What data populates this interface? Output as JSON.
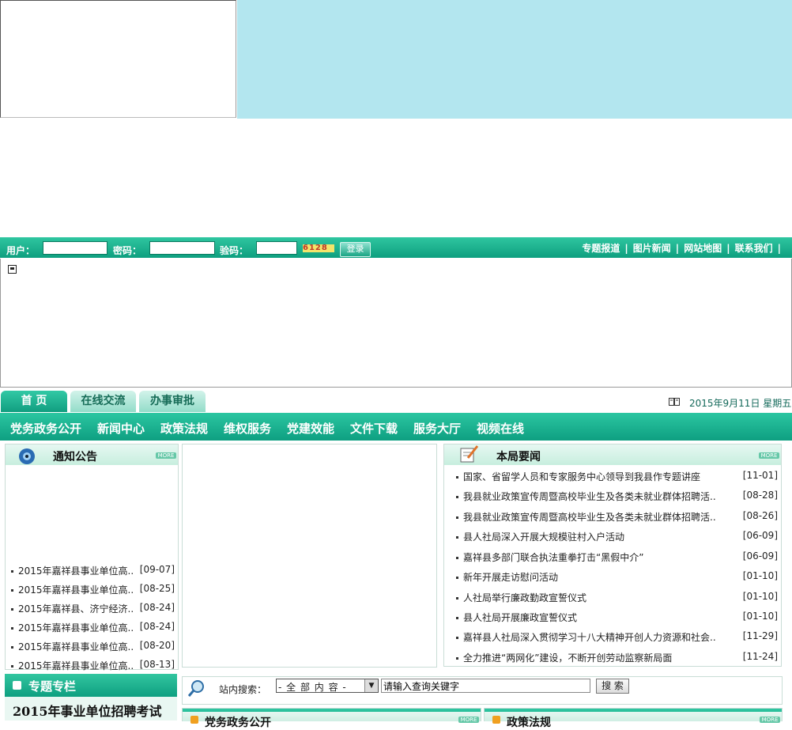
{
  "login": {
    "user_label": "用户：",
    "password_label": "密码：",
    "captcha_label": "验码：",
    "captcha_value": "6128",
    "login_button": "登录",
    "links": [
      "专题报道",
      "图片新闻",
      "网站地图",
      "联系我们"
    ]
  },
  "tabs": [
    "首 页",
    "在线交流",
    "办事审批"
  ],
  "date_text": "2015年9月11日 星期五",
  "nav": [
    "党务政务公开",
    "新闻中心",
    "政策法规",
    "维权服务",
    "党建效能",
    "文件下载",
    "服务大厅",
    "视频在线"
  ],
  "notice": {
    "title": "通知公告",
    "more": "MORE",
    "items": [
      {
        "title": "2015年嘉祥县事业单位高..",
        "date": "[09-07]"
      },
      {
        "title": "2015年嘉祥县事业单位高..",
        "date": "[08-25]"
      },
      {
        "title": "2015年嘉祥县、济宁经济..",
        "date": "[08-24]"
      },
      {
        "title": "2015年嘉祥县事业单位高..",
        "date": "[08-24]"
      },
      {
        "title": "2015年嘉祥县事业单位高..",
        "date": "[08-20]"
      },
      {
        "title": "2015年嘉祥县事业单位高..",
        "date": "[08-13]"
      }
    ]
  },
  "news": {
    "title": "本局要闻",
    "more": "MORE",
    "items": [
      {
        "title": "国家、省留学人员和专家服务中心领导到我县作专题讲座",
        "date": "[11-01]"
      },
      {
        "title": "我县就业政策宣传周暨高校毕业生及各类未就业群体招聘活..",
        "date": "[08-28]"
      },
      {
        "title": "我县就业政策宣传周暨高校毕业生及各类未就业群体招聘活..",
        "date": "[08-26]"
      },
      {
        "title": "县人社局深入开展大规模驻村入户活动",
        "date": "[06-09]"
      },
      {
        "title": "嘉祥县多部门联合执法重拳打击“黑假中介”",
        "date": "[06-09]"
      },
      {
        "title": "新年开展走访慰问活动",
        "date": "[01-10]"
      },
      {
        "title": "人社局举行廉政勤政宣誓仪式",
        "date": "[01-10]"
      },
      {
        "title": "县人社局开展廉政宣誓仪式",
        "date": "[01-10]"
      },
      {
        "title": "嘉祥县人社局深入贯彻学习十八大精神开创人力资源和社会..",
        "date": "[11-29]"
      },
      {
        "title": "全力推进“两网化”建设，不断开创劳动监察新局面",
        "date": "[11-24]"
      }
    ]
  },
  "search": {
    "label": "站内搜索：",
    "scope": "- 全 部 内 容 -",
    "placeholder": "请输入查询关键字",
    "button": "搜 索"
  },
  "special": {
    "title": "专题专栏",
    "promo": "2015年事业单位招聘考试"
  },
  "bottom": {
    "left_title": "党务政务公开",
    "right_title": "政策法规",
    "more": "MORE"
  }
}
